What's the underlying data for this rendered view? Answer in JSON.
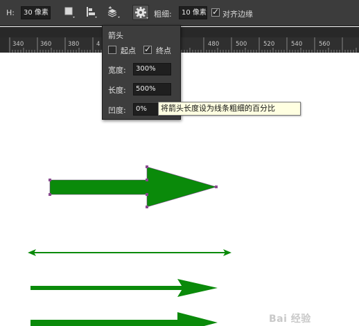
{
  "toolbar": {
    "h_label": "H:",
    "h_value": "30 像素",
    "weight_label": "粗细:",
    "weight_value": "10 像素",
    "align_edges_label": "对齐边缘",
    "align_edges_checked": true
  },
  "ruler": {
    "ticks": [
      "340",
      "360",
      "380",
      "4",
      "480",
      "500",
      "520",
      "540",
      "560"
    ]
  },
  "arrow_popup": {
    "title": "箭头",
    "start_label": "起点",
    "start_checked": false,
    "end_label": "终点",
    "end_checked": true,
    "width_label": "宽度:",
    "width_value": "300%",
    "length_label": "长度:",
    "length_value": "500%",
    "concavity_label": "凹度:",
    "concavity_value": "0%"
  },
  "tooltip": {
    "text": "将箭头长度设为线条粗细的百分比"
  },
  "canvas": {
    "shape_color": "#0a8a0a",
    "path_point_color": "#7a4a8a"
  },
  "watermark": {
    "text": "Bai 经验"
  }
}
